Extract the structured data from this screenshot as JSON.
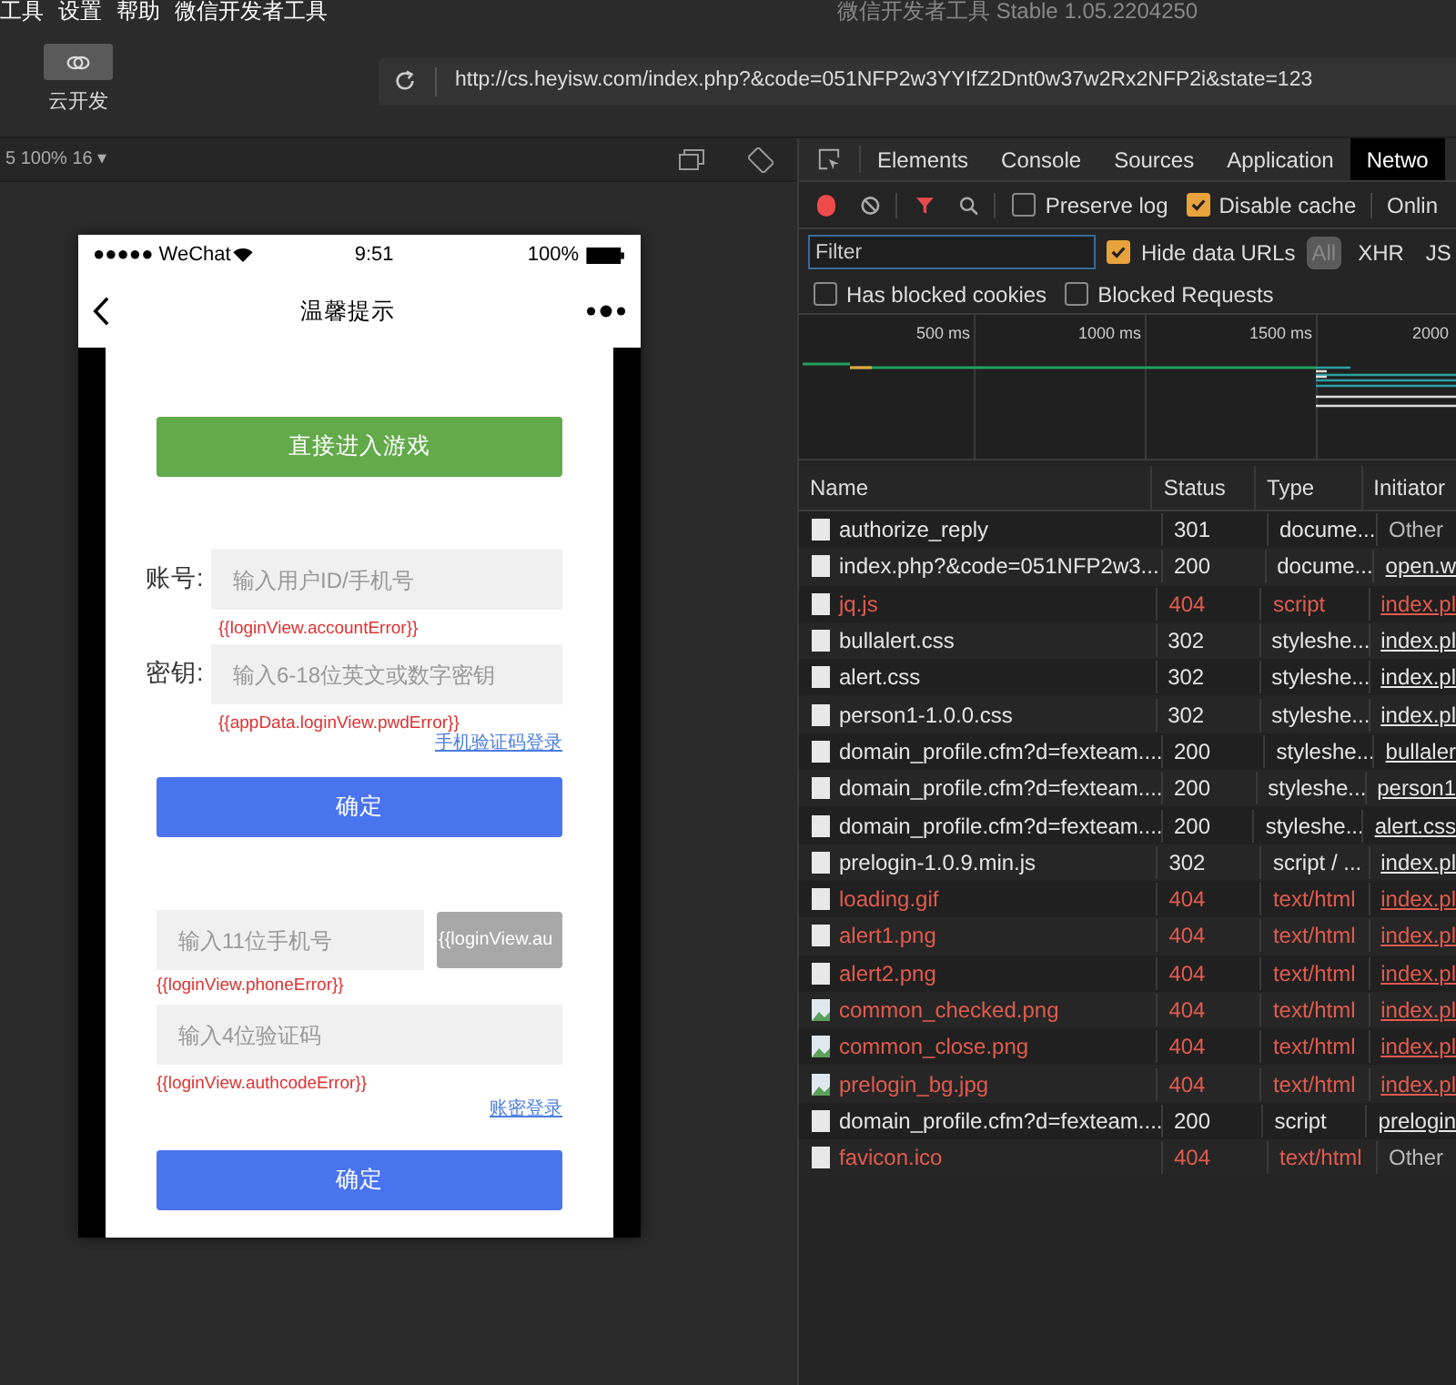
{
  "menu": [
    "工具",
    "设置",
    "帮助",
    "微信开发者工具"
  ],
  "window": {
    "title": "微信开发者工具 Stable 1.05.2204250"
  },
  "toolbar": {
    "cloud_button": "云开发",
    "url": "http://cs.heyisw.com/index.php?&code=051NFP2w3YYIfZ2Dnt0w37w2Rx2NFP2i&state=123"
  },
  "simulator_bar": {
    "device": "5 100% 16 ▾"
  },
  "phone": {
    "status": {
      "carrier": "●●●●● WeChat",
      "time": "9:51",
      "battery": "100%"
    },
    "nav_title": "温馨提示",
    "enter_button": "直接进入游戏",
    "account": {
      "label": "账号:",
      "placeholder": "输入用户ID/手机号",
      "error": "{{loginView.accountError}}"
    },
    "password": {
      "label": "密钥:",
      "placeholder": "输入6-18位英文或数字密钥",
      "error": "{{appData.loginView.pwdError}}"
    },
    "sms_link": "手机验证码登录",
    "confirm_1": "确定",
    "phone_field": {
      "placeholder": "输入11位手机号",
      "error": "{{loginView.phoneError}}"
    },
    "code_button": "{{loginView.au",
    "code_field": {
      "placeholder": "输入4位验证码",
      "error": "{{loginView.authcodeError}}"
    },
    "account_link": "账密登录",
    "confirm_2": "确定"
  },
  "devtools": {
    "tabs": [
      {
        "label": "Elements",
        "selected": false
      },
      {
        "label": "Console",
        "selected": false
      },
      {
        "label": "Sources",
        "selected": false
      },
      {
        "label": "Application",
        "selected": false
      },
      {
        "label": "Netwo",
        "selected": true
      }
    ],
    "options": [
      {
        "label": "Preserve log",
        "checked": false
      },
      {
        "label": "Disable cache",
        "checked": true
      }
    ],
    "throttle": "Onlin",
    "filter_placeholder": "Filter",
    "hide_data_urls": {
      "label": "Hide data URLs",
      "checked": true
    },
    "type_filters": [
      {
        "label": "All",
        "selected": true
      },
      {
        "label": "XHR",
        "selected": false
      },
      {
        "label": "JS",
        "selected": false
      }
    ],
    "blocked": [
      {
        "label": "Has blocked cookies",
        "checked": false
      },
      {
        "label": "Blocked Requests",
        "checked": false
      }
    ],
    "timeline_ticks": [
      "500 ms",
      "1000 ms",
      "1500 ms",
      "2000"
    ],
    "columns": [
      "Name",
      "Status",
      "Type",
      "Initiator"
    ],
    "rows": [
      {
        "name": "authorize_reply",
        "status": "301",
        "type": "docume...",
        "initiator": "Other",
        "initiator_link": false,
        "error": false,
        "kind": "doc"
      },
      {
        "name": "index.php?&code=051NFP2w3...",
        "status": "200",
        "type": "docume...",
        "initiator": "open.w",
        "initiator_link": true,
        "error": false,
        "kind": "doc"
      },
      {
        "name": "jq.js",
        "status": "404",
        "type": "script",
        "initiator": "index.pl",
        "initiator_link": true,
        "error": true,
        "kind": "doc"
      },
      {
        "name": "bullalert.css",
        "status": "302",
        "type": "styleshe...",
        "initiator": "index.pl",
        "initiator_link": true,
        "error": false,
        "kind": "doc"
      },
      {
        "name": "alert.css",
        "status": "302",
        "type": "styleshe...",
        "initiator": "index.pl",
        "initiator_link": true,
        "error": false,
        "kind": "doc"
      },
      {
        "name": "person1-1.0.0.css",
        "status": "302",
        "type": "styleshe...",
        "initiator": "index.pl",
        "initiator_link": true,
        "error": false,
        "kind": "doc"
      },
      {
        "name": "domain_profile.cfm?d=fexteam....",
        "status": "200",
        "type": "styleshe...",
        "initiator": "bullaler",
        "initiator_link": true,
        "error": false,
        "kind": "doc"
      },
      {
        "name": "domain_profile.cfm?d=fexteam....",
        "status": "200",
        "type": "styleshe...",
        "initiator": "person1",
        "initiator_link": true,
        "error": false,
        "kind": "doc"
      },
      {
        "name": "domain_profile.cfm?d=fexteam....",
        "status": "200",
        "type": "styleshe...",
        "initiator": "alert.css",
        "initiator_link": true,
        "error": false,
        "kind": "doc"
      },
      {
        "name": "prelogin-1.0.9.min.js",
        "status": "302",
        "type": "script / ...",
        "initiator": "index.pl",
        "initiator_link": true,
        "error": false,
        "kind": "doc"
      },
      {
        "name": "loading.gif",
        "status": "404",
        "type": "text/html",
        "initiator": "index.pl",
        "initiator_link": true,
        "error": true,
        "kind": "doc"
      },
      {
        "name": "alert1.png",
        "status": "404",
        "type": "text/html",
        "initiator": "index.pl",
        "initiator_link": true,
        "error": true,
        "kind": "doc"
      },
      {
        "name": "alert2.png",
        "status": "404",
        "type": "text/html",
        "initiator": "index.pl",
        "initiator_link": true,
        "error": true,
        "kind": "doc"
      },
      {
        "name": "common_checked.png",
        "status": "404",
        "type": "text/html",
        "initiator": "index.pl",
        "initiator_link": true,
        "error": true,
        "kind": "image"
      },
      {
        "name": "common_close.png",
        "status": "404",
        "type": "text/html",
        "initiator": "index.pl",
        "initiator_link": true,
        "error": true,
        "kind": "image"
      },
      {
        "name": "prelogin_bg.jpg",
        "status": "404",
        "type": "text/html",
        "initiator": "index.pl",
        "initiator_link": true,
        "error": true,
        "kind": "image"
      },
      {
        "name": "domain_profile.cfm?d=fexteam....",
        "status": "200",
        "type": "script",
        "initiator": "prelogin",
        "initiator_link": true,
        "error": false,
        "kind": "doc"
      },
      {
        "name": "favicon.ico",
        "status": "404",
        "type": "text/html",
        "initiator": "Other",
        "initiator_link": false,
        "error": true,
        "kind": "doc"
      }
    ]
  }
}
